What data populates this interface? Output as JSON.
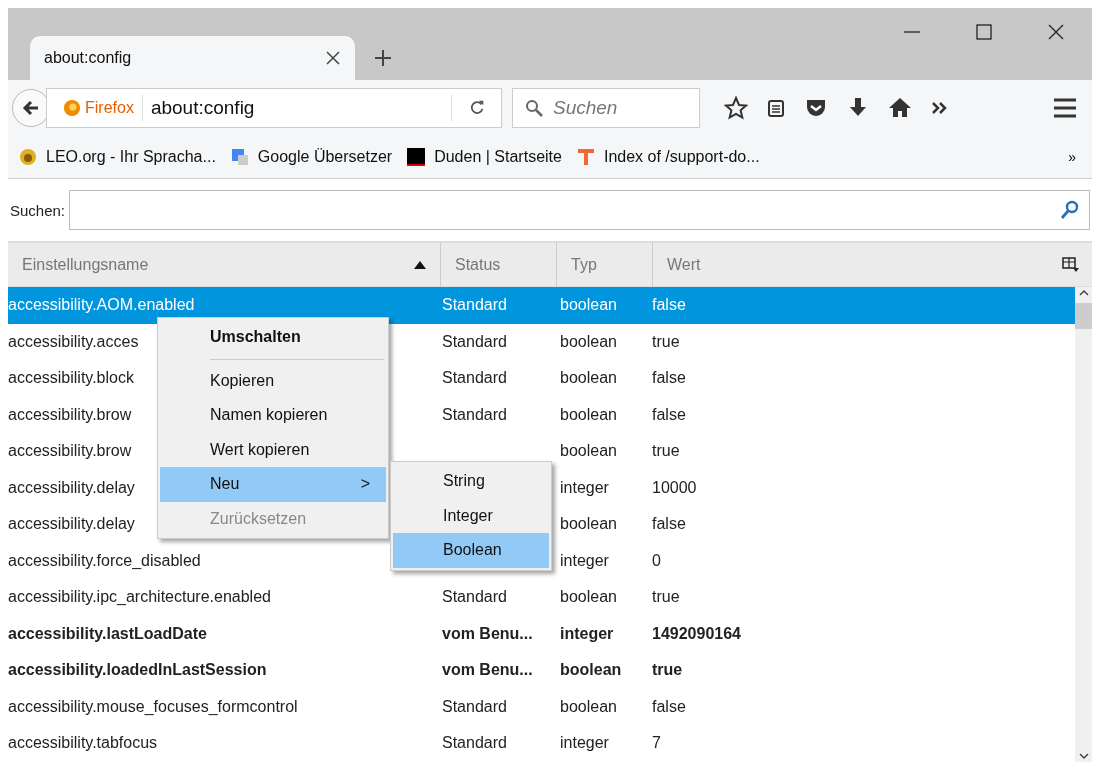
{
  "tabs": [
    {
      "title": "about:config",
      "selected": true
    }
  ],
  "navbar": {
    "identity": "Firefox",
    "url": "about:config",
    "search_placeholder": "Suchen"
  },
  "bookmarks": [
    {
      "label": "LEO.org - Ihr Spracha..."
    },
    {
      "label": "Google Übersetzer"
    },
    {
      "label": "Duden | Startseite"
    },
    {
      "label": "Index of /support-do..."
    }
  ],
  "bookmarks_overflow": "»",
  "filter": {
    "label": "Suchen:"
  },
  "table": {
    "columns": [
      {
        "label": "Einstellungsname",
        "sorted": true
      },
      {
        "label": "Status",
        "sorted": false
      },
      {
        "label": "Typ",
        "sorted": false
      },
      {
        "label": "Wert",
        "sorted": false
      }
    ],
    "rows": [
      {
        "name": "accessibility.AOM.enabled",
        "status": "Standard",
        "type": "boolean",
        "value": "false",
        "selected": true,
        "modified": false
      },
      {
        "name": "accessibility.acces",
        "status": "Standard",
        "type": "boolean",
        "value": "true",
        "selected": false,
        "modified": false
      },
      {
        "name": "accessibility.block",
        "status": "Standard",
        "type": "boolean",
        "value": "false",
        "selected": false,
        "modified": false
      },
      {
        "name": "accessibility.brow",
        "status": "Standard",
        "type": "boolean",
        "value": "false",
        "selected": false,
        "modified": false
      },
      {
        "name": "accessibility.brow",
        "type": "boolean",
        "value": "true",
        "selected": false,
        "modified": false
      },
      {
        "name": "accessibility.delay",
        "type": "integer",
        "value": "10000",
        "selected": false,
        "modified": false
      },
      {
        "name": "accessibility.delay",
        "type": "boolean",
        "value": "false",
        "selected": false,
        "modified": false
      },
      {
        "name": "accessibility.force_disabled",
        "type": "integer",
        "value": "0",
        "selected": false,
        "modified": false
      },
      {
        "name": "accessibility.ipc_architecture.enabled",
        "status": "Standard",
        "type": "boolean",
        "value": "true",
        "selected": false,
        "modified": false
      },
      {
        "name": "accessibility.lastLoadDate",
        "status": "vom Benu...",
        "type": "integer",
        "value": "1492090164",
        "selected": false,
        "modified": true
      },
      {
        "name": "accessibility.loadedInLastSession",
        "status": "vom Benu...",
        "type": "boolean",
        "value": "true",
        "selected": false,
        "modified": true
      },
      {
        "name": "accessibility.mouse_focuses_formcontrol",
        "status": "Standard",
        "type": "boolean",
        "value": "false",
        "selected": false,
        "modified": false
      },
      {
        "name": "accessibility.tabfocus",
        "status": "Standard",
        "type": "integer",
        "value": "7",
        "selected": false,
        "modified": false
      }
    ]
  },
  "context_menu": {
    "items": [
      {
        "kind": "default",
        "label": "Umschalten",
        "selected": false,
        "disabled": false
      },
      {
        "kind": "separator"
      },
      {
        "kind": "item",
        "label": "Kopieren",
        "selected": false,
        "disabled": false
      },
      {
        "kind": "item",
        "label": "Namen kopieren",
        "selected": false,
        "disabled": false
      },
      {
        "kind": "item",
        "label": "Wert kopieren",
        "selected": false,
        "disabled": false
      },
      {
        "kind": "submenu",
        "label": "Neu",
        "arrow": ">",
        "selected": true,
        "disabled": false
      },
      {
        "kind": "item",
        "label": "Zurücksetzen",
        "selected": false,
        "disabled": true
      }
    ]
  },
  "submenu": {
    "items": [
      {
        "label": "String",
        "selected": false
      },
      {
        "label": "Integer",
        "selected": false
      },
      {
        "label": "Boolean",
        "selected": true
      }
    ]
  }
}
